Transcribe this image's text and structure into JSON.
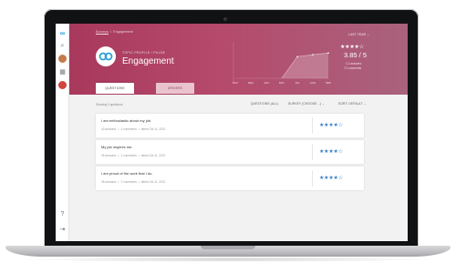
{
  "breadcrumb": {
    "parent": "Surveys",
    "current": "Engagement"
  },
  "header": {
    "subtitle": "TOPIC PROFILE / PULSE",
    "title": "Engagement",
    "period_filter": "LAST YEAR",
    "period_chevron": "⌄",
    "score_stars": "★★★★☆",
    "score": "3.85 / 5",
    "score_sub1": "1.2 answers",
    "score_sub2": "72 comments"
  },
  "chart_data": {
    "type": "area",
    "categories": [
      "NOV",
      "DEC",
      "JAN",
      "MAY",
      "JUL",
      "AUG",
      "SEP"
    ],
    "values": [
      0,
      0,
      0,
      0,
      3.3,
      3.6,
      3.85
    ],
    "xlabel": "",
    "ylabel": "",
    "ylim": [
      0,
      5
    ]
  },
  "tabs": [
    {
      "label": "QUESTIONS"
    },
    {
      "label": "DRIVERS"
    }
  ],
  "toolbar": {
    "showing": "Showing 3 questions",
    "question_filter": "QUESTIONS (ALL)",
    "survey_filter": "SURVEY (CHOOSE...)",
    "sort": "SORT: DEFAULT",
    "chevron": "⌄"
  },
  "questions": [
    {
      "text": "I am enthusiastic about my job.",
      "answers": "40 answers",
      "comments": "4 comments",
      "latest": "latest Oct 11, 2021",
      "stars": "★★★★☆"
    },
    {
      "text": "My job inspires me.",
      "answers": "35 answers",
      "comments": "2 comments",
      "latest": "latest Oct 11, 2021",
      "stars": "★★★★☆"
    },
    {
      "text": "I am proud of the work that I do.",
      "answers": "38 answers",
      "comments": "2 comments",
      "latest": "latest Oct 11, 2021",
      "stars": "★★★★☆"
    }
  ],
  "meta_sep": "•",
  "sidebar": {
    "logo": "∞",
    "search": "⌕",
    "grid": "▦",
    "settings": "⚙",
    "help": "?",
    "logout": "⇥"
  },
  "colors": {
    "header_start": "#a8395d",
    "header_end": "#a9627d",
    "accent_star": "#3b7fc4",
    "logo": "#2a9fd6"
  }
}
